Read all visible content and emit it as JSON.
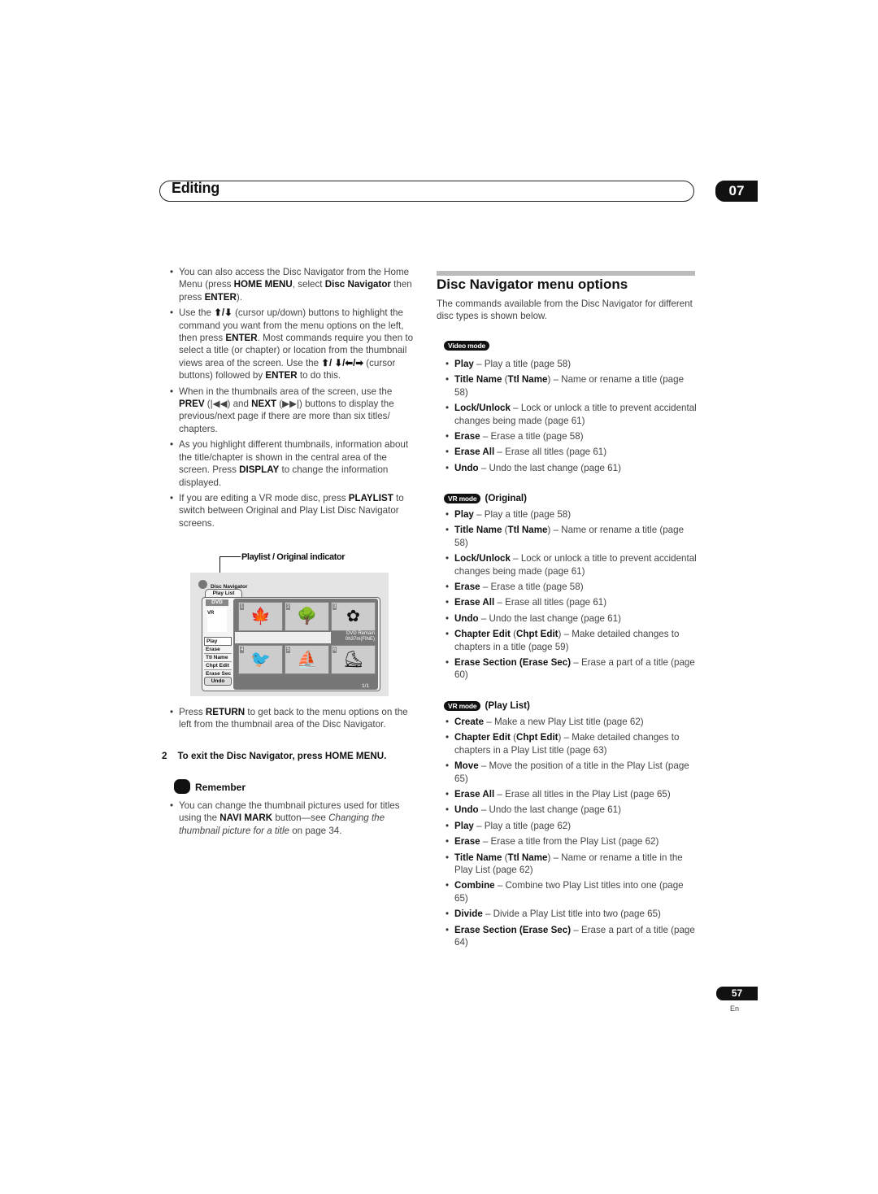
{
  "header": {
    "section": "Editing",
    "chapter": "07"
  },
  "left": {
    "bullets": [
      [
        {
          "t": "You can also access the Disc Navigator from the Home Menu (press "
        },
        {
          "b": 1,
          "t": "HOME MENU"
        },
        {
          "t": ", select "
        },
        {
          "b": 1,
          "t": "Disc Navigator"
        },
        {
          "t": " then press "
        },
        {
          "b": 1,
          "t": "ENTER"
        },
        {
          "t": ")."
        }
      ],
      [
        {
          "t": "Use the "
        },
        {
          "b": 1,
          "t": "⬆/⬇"
        },
        {
          "t": " (cursor up/down) buttons to highlight the command you want from the menu options on the left, then press "
        },
        {
          "b": 1,
          "t": "ENTER"
        },
        {
          "t": ". Most commands require you then to select a title (or chapter) or location from the thumbnail views area of the screen. Use the "
        },
        {
          "b": 1,
          "t": "⬆/ ⬇/⬅/➡"
        },
        {
          "t": " (cursor buttons) followed by "
        },
        {
          "b": 1,
          "t": "ENTER"
        },
        {
          "t": " to do this."
        }
      ],
      [
        {
          "t": "When in the thumbnails area of the screen, use the "
        },
        {
          "b": 1,
          "t": "PREV"
        },
        {
          "t": " (|◀◀) and "
        },
        {
          "b": 1,
          "t": "NEXT"
        },
        {
          "t": " (▶▶|) buttons to display the previous/next page if there are more than six titles/ chapters."
        }
      ],
      [
        {
          "t": "As you highlight different thumbnails, information about the title/chapter is shown in the central area of the screen. Press "
        },
        {
          "b": 1,
          "t": "DISPLAY"
        },
        {
          "t": " to change the information displayed."
        }
      ],
      [
        {
          "t": "If you are editing a VR mode disc, press "
        },
        {
          "b": 1,
          "t": "PLAYLIST"
        },
        {
          "t": " to switch between Original and Play List Disc Navigator screens."
        }
      ]
    ],
    "figure": {
      "indicator_label": "Playlist / Original indicator",
      "title": "Disc Navigator",
      "tab": "Play List",
      "disc_type": "DVD",
      "disc_mode": "VR",
      "menu": [
        "Play",
        "Erase",
        "Ttl Name",
        "Chpt Edit",
        "Erase Sec"
      ],
      "undo": "Undo",
      "thumbs": [
        {
          "n": "1",
          "icon": "leaf-icon",
          "g": "🍁"
        },
        {
          "n": "2",
          "icon": "tree-icon",
          "g": "🌳"
        },
        {
          "n": "3",
          "icon": "lily-icon",
          "g": "✿"
        },
        {
          "n": "4",
          "icon": "toucan-icon",
          "g": "🐦"
        },
        {
          "n": "5",
          "icon": "windsurfer-icon",
          "g": "⛵"
        },
        {
          "n": "6",
          "icon": "skater-icon",
          "g": "⛸"
        }
      ],
      "remain_label": "DVD Remain",
      "remain_value": "0h37m(FINE)",
      "page": "1/1"
    },
    "bullets2": [
      [
        {
          "t": "Press "
        },
        {
          "b": 1,
          "t": "RETURN"
        },
        {
          "t": " to get back to the menu options on the left from the thumbnail area of the Disc Navigator."
        }
      ]
    ],
    "step": {
      "num": "2",
      "text": "To exit the Disc Navigator, press HOME MENU"
    },
    "remember": {
      "title": "Remember",
      "bullets": [
        [
          {
            "t": "You can change the thumbnail pictures used for titles using the "
          },
          {
            "b": 1,
            "t": "NAVI MARK"
          },
          {
            "t": " button—see "
          },
          {
            "i": 1,
            "t": "Changing the thumbnail picture for a title"
          },
          {
            "t": " on page 34."
          }
        ]
      ]
    }
  },
  "right": {
    "title": "Disc Navigator menu options",
    "intro": "The commands available from the Disc Navigator for different disc types is shown below.",
    "sections": [
      {
        "badge": "Video mode",
        "label": "",
        "items": [
          [
            {
              "b": 1,
              "t": "Play"
            },
            {
              "t": " – Play a title (page 58)"
            }
          ],
          [
            {
              "b": 1,
              "t": "Title Name"
            },
            {
              "t": " ("
            },
            {
              "b": 1,
              "t": "Ttl Name"
            },
            {
              "t": ") – Name or rename a title (page 58)"
            }
          ],
          [
            {
              "b": 1,
              "t": "Lock/Unlock"
            },
            {
              "t": " – Lock or unlock a title to prevent accidental changes being made (page 61)"
            }
          ],
          [
            {
              "b": 1,
              "t": "Erase"
            },
            {
              "t": " – Erase a title (page 58)"
            }
          ],
          [
            {
              "b": 1,
              "t": "Erase All"
            },
            {
              "t": " – Erase all titles (page 61)"
            }
          ],
          [
            {
              "b": 1,
              "t": "Undo"
            },
            {
              "t": " – Undo the last change (page 61)"
            }
          ]
        ]
      },
      {
        "badge": "VR mode",
        "label": "(Original)",
        "items": [
          [
            {
              "b": 1,
              "t": "Play"
            },
            {
              "t": " – Play a title (page 58)"
            }
          ],
          [
            {
              "b": 1,
              "t": "Title Name"
            },
            {
              "t": " ("
            },
            {
              "b": 1,
              "t": "Ttl Name"
            },
            {
              "t": ") – Name or rename a title (page 58)"
            }
          ],
          [
            {
              "b": 1,
              "t": "Lock/Unlock"
            },
            {
              "t": " – Lock or unlock a title to prevent accidental changes being made (page 61)"
            }
          ],
          [
            {
              "b": 1,
              "t": "Erase"
            },
            {
              "t": " – Erase a title (page 58)"
            }
          ],
          [
            {
              "b": 1,
              "t": "Erase All"
            },
            {
              "t": " – Erase all titles (page 61)"
            }
          ],
          [
            {
              "b": 1,
              "t": "Undo"
            },
            {
              "t": " – Undo the last change (page 61)"
            }
          ],
          [
            {
              "b": 1,
              "t": "Chapter Edit"
            },
            {
              "t": " ("
            },
            {
              "b": 1,
              "t": "Chpt Edit"
            },
            {
              "t": ") – Make detailed changes to chapters in a title (page 59)"
            }
          ],
          [
            {
              "b": 1,
              "t": "Erase Section (Erase Sec)"
            },
            {
              "t": " – Erase a part of a title (page 60)"
            }
          ]
        ]
      },
      {
        "badge": "VR mode",
        "label": "(Play List)",
        "items": [
          [
            {
              "b": 1,
              "t": "Create"
            },
            {
              "t": " – Make a new Play List title (page 62)"
            }
          ],
          [
            {
              "b": 1,
              "t": "Chapter Edit"
            },
            {
              "t": " ("
            },
            {
              "b": 1,
              "t": "Chpt Edit"
            },
            {
              "t": ") – Make detailed changes to chapters in a Play List title (page 63)"
            }
          ],
          [
            {
              "b": 1,
              "t": "Move"
            },
            {
              "t": " – Move the position of a title in the Play List (page 65)"
            }
          ],
          [
            {
              "b": 1,
              "t": "Erase All"
            },
            {
              "t": " – Erase all titles in the Play List (page 65)"
            }
          ],
          [
            {
              "b": 1,
              "t": "Undo"
            },
            {
              "t": " – Undo the last change (page 61)"
            }
          ],
          [
            {
              "b": 1,
              "t": "Play"
            },
            {
              "t": " – Play a title (page 62)"
            }
          ],
          [
            {
              "b": 1,
              "t": "Erase"
            },
            {
              "t": " – Erase a title from the Play List (page 62)"
            }
          ],
          [
            {
              "b": 1,
              "t": "Title Name"
            },
            {
              "t": " ("
            },
            {
              "b": 1,
              "t": "Ttl Name"
            },
            {
              "t": ") – Name or rename a title in the Play List (page 62)"
            }
          ],
          [
            {
              "b": 1,
              "t": "Combine"
            },
            {
              "t": " – Combine two Play List titles into one (page 65)"
            }
          ],
          [
            {
              "b": 1,
              "t": "Divide"
            },
            {
              "t": " – Divide a Play List title into two (page 65)"
            }
          ],
          [
            {
              "b": 1,
              "t": "Erase Section (Erase Sec)"
            },
            {
              "t": " – Erase a part of a title (page 64)"
            }
          ]
        ]
      }
    ]
  },
  "footer": {
    "page": "57",
    "lang": "En"
  }
}
